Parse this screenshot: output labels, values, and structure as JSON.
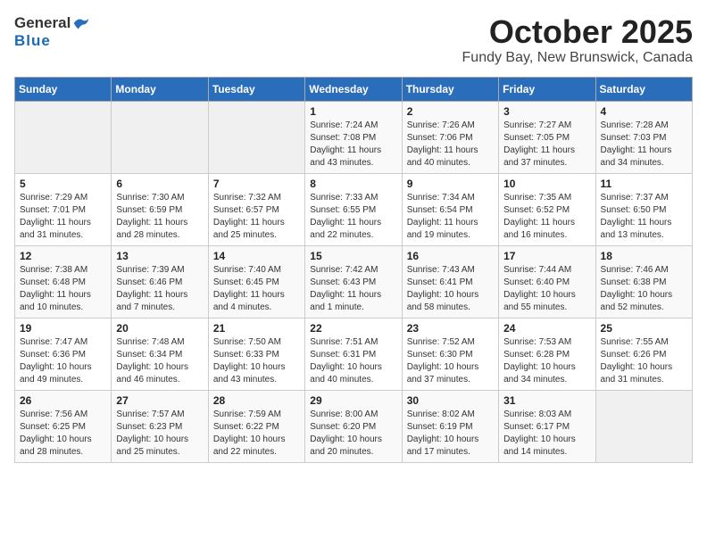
{
  "header": {
    "logo_line1": "General",
    "logo_line2": "Blue",
    "month_title": "October 2025",
    "location": "Fundy Bay, New Brunswick, Canada"
  },
  "days_of_week": [
    "Sunday",
    "Monday",
    "Tuesday",
    "Wednesday",
    "Thursday",
    "Friday",
    "Saturday"
  ],
  "weeks": [
    [
      {
        "day": "",
        "info": ""
      },
      {
        "day": "",
        "info": ""
      },
      {
        "day": "",
        "info": ""
      },
      {
        "day": "1",
        "info": "Sunrise: 7:24 AM\nSunset: 7:08 PM\nDaylight: 11 hours\nand 43 minutes."
      },
      {
        "day": "2",
        "info": "Sunrise: 7:26 AM\nSunset: 7:06 PM\nDaylight: 11 hours\nand 40 minutes."
      },
      {
        "day": "3",
        "info": "Sunrise: 7:27 AM\nSunset: 7:05 PM\nDaylight: 11 hours\nand 37 minutes."
      },
      {
        "day": "4",
        "info": "Sunrise: 7:28 AM\nSunset: 7:03 PM\nDaylight: 11 hours\nand 34 minutes."
      }
    ],
    [
      {
        "day": "5",
        "info": "Sunrise: 7:29 AM\nSunset: 7:01 PM\nDaylight: 11 hours\nand 31 minutes."
      },
      {
        "day": "6",
        "info": "Sunrise: 7:30 AM\nSunset: 6:59 PM\nDaylight: 11 hours\nand 28 minutes."
      },
      {
        "day": "7",
        "info": "Sunrise: 7:32 AM\nSunset: 6:57 PM\nDaylight: 11 hours\nand 25 minutes."
      },
      {
        "day": "8",
        "info": "Sunrise: 7:33 AM\nSunset: 6:55 PM\nDaylight: 11 hours\nand 22 minutes."
      },
      {
        "day": "9",
        "info": "Sunrise: 7:34 AM\nSunset: 6:54 PM\nDaylight: 11 hours\nand 19 minutes."
      },
      {
        "day": "10",
        "info": "Sunrise: 7:35 AM\nSunset: 6:52 PM\nDaylight: 11 hours\nand 16 minutes."
      },
      {
        "day": "11",
        "info": "Sunrise: 7:37 AM\nSunset: 6:50 PM\nDaylight: 11 hours\nand 13 minutes."
      }
    ],
    [
      {
        "day": "12",
        "info": "Sunrise: 7:38 AM\nSunset: 6:48 PM\nDaylight: 11 hours\nand 10 minutes."
      },
      {
        "day": "13",
        "info": "Sunrise: 7:39 AM\nSunset: 6:46 PM\nDaylight: 11 hours\nand 7 minutes."
      },
      {
        "day": "14",
        "info": "Sunrise: 7:40 AM\nSunset: 6:45 PM\nDaylight: 11 hours\nand 4 minutes."
      },
      {
        "day": "15",
        "info": "Sunrise: 7:42 AM\nSunset: 6:43 PM\nDaylight: 11 hours\nand 1 minute."
      },
      {
        "day": "16",
        "info": "Sunrise: 7:43 AM\nSunset: 6:41 PM\nDaylight: 10 hours\nand 58 minutes."
      },
      {
        "day": "17",
        "info": "Sunrise: 7:44 AM\nSunset: 6:40 PM\nDaylight: 10 hours\nand 55 minutes."
      },
      {
        "day": "18",
        "info": "Sunrise: 7:46 AM\nSunset: 6:38 PM\nDaylight: 10 hours\nand 52 minutes."
      }
    ],
    [
      {
        "day": "19",
        "info": "Sunrise: 7:47 AM\nSunset: 6:36 PM\nDaylight: 10 hours\nand 49 minutes."
      },
      {
        "day": "20",
        "info": "Sunrise: 7:48 AM\nSunset: 6:34 PM\nDaylight: 10 hours\nand 46 minutes."
      },
      {
        "day": "21",
        "info": "Sunrise: 7:50 AM\nSunset: 6:33 PM\nDaylight: 10 hours\nand 43 minutes."
      },
      {
        "day": "22",
        "info": "Sunrise: 7:51 AM\nSunset: 6:31 PM\nDaylight: 10 hours\nand 40 minutes."
      },
      {
        "day": "23",
        "info": "Sunrise: 7:52 AM\nSunset: 6:30 PM\nDaylight: 10 hours\nand 37 minutes."
      },
      {
        "day": "24",
        "info": "Sunrise: 7:53 AM\nSunset: 6:28 PM\nDaylight: 10 hours\nand 34 minutes."
      },
      {
        "day": "25",
        "info": "Sunrise: 7:55 AM\nSunset: 6:26 PM\nDaylight: 10 hours\nand 31 minutes."
      }
    ],
    [
      {
        "day": "26",
        "info": "Sunrise: 7:56 AM\nSunset: 6:25 PM\nDaylight: 10 hours\nand 28 minutes."
      },
      {
        "day": "27",
        "info": "Sunrise: 7:57 AM\nSunset: 6:23 PM\nDaylight: 10 hours\nand 25 minutes."
      },
      {
        "day": "28",
        "info": "Sunrise: 7:59 AM\nSunset: 6:22 PM\nDaylight: 10 hours\nand 22 minutes."
      },
      {
        "day": "29",
        "info": "Sunrise: 8:00 AM\nSunset: 6:20 PM\nDaylight: 10 hours\nand 20 minutes."
      },
      {
        "day": "30",
        "info": "Sunrise: 8:02 AM\nSunset: 6:19 PM\nDaylight: 10 hours\nand 17 minutes."
      },
      {
        "day": "31",
        "info": "Sunrise: 8:03 AM\nSunset: 6:17 PM\nDaylight: 10 hours\nand 14 minutes."
      },
      {
        "day": "",
        "info": ""
      }
    ]
  ]
}
